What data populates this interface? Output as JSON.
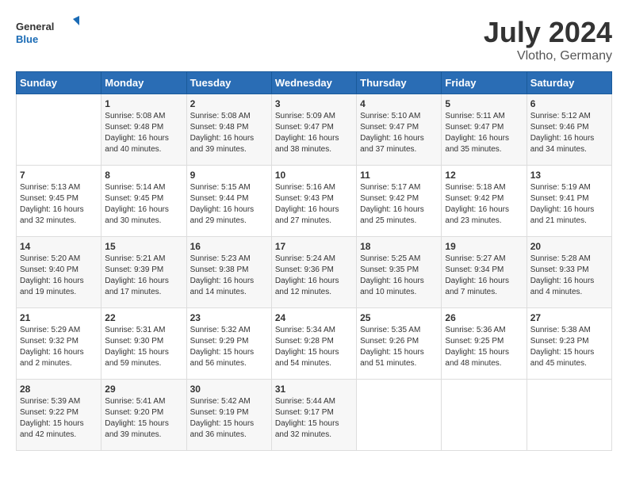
{
  "header": {
    "logo_line1": "General",
    "logo_line2": "Blue",
    "month": "July 2024",
    "location": "Vlotho, Germany"
  },
  "weekdays": [
    "Sunday",
    "Monday",
    "Tuesday",
    "Wednesday",
    "Thursday",
    "Friday",
    "Saturday"
  ],
  "weeks": [
    [
      {
        "day": "",
        "info": ""
      },
      {
        "day": "1",
        "info": "Sunrise: 5:08 AM\nSunset: 9:48 PM\nDaylight: 16 hours\nand 40 minutes."
      },
      {
        "day": "2",
        "info": "Sunrise: 5:08 AM\nSunset: 9:48 PM\nDaylight: 16 hours\nand 39 minutes."
      },
      {
        "day": "3",
        "info": "Sunrise: 5:09 AM\nSunset: 9:47 PM\nDaylight: 16 hours\nand 38 minutes."
      },
      {
        "day": "4",
        "info": "Sunrise: 5:10 AM\nSunset: 9:47 PM\nDaylight: 16 hours\nand 37 minutes."
      },
      {
        "day": "5",
        "info": "Sunrise: 5:11 AM\nSunset: 9:47 PM\nDaylight: 16 hours\nand 35 minutes."
      },
      {
        "day": "6",
        "info": "Sunrise: 5:12 AM\nSunset: 9:46 PM\nDaylight: 16 hours\nand 34 minutes."
      }
    ],
    [
      {
        "day": "7",
        "info": "Sunrise: 5:13 AM\nSunset: 9:45 PM\nDaylight: 16 hours\nand 32 minutes."
      },
      {
        "day": "8",
        "info": "Sunrise: 5:14 AM\nSunset: 9:45 PM\nDaylight: 16 hours\nand 30 minutes."
      },
      {
        "day": "9",
        "info": "Sunrise: 5:15 AM\nSunset: 9:44 PM\nDaylight: 16 hours\nand 29 minutes."
      },
      {
        "day": "10",
        "info": "Sunrise: 5:16 AM\nSunset: 9:43 PM\nDaylight: 16 hours\nand 27 minutes."
      },
      {
        "day": "11",
        "info": "Sunrise: 5:17 AM\nSunset: 9:42 PM\nDaylight: 16 hours\nand 25 minutes."
      },
      {
        "day": "12",
        "info": "Sunrise: 5:18 AM\nSunset: 9:42 PM\nDaylight: 16 hours\nand 23 minutes."
      },
      {
        "day": "13",
        "info": "Sunrise: 5:19 AM\nSunset: 9:41 PM\nDaylight: 16 hours\nand 21 minutes."
      }
    ],
    [
      {
        "day": "14",
        "info": "Sunrise: 5:20 AM\nSunset: 9:40 PM\nDaylight: 16 hours\nand 19 minutes."
      },
      {
        "day": "15",
        "info": "Sunrise: 5:21 AM\nSunset: 9:39 PM\nDaylight: 16 hours\nand 17 minutes."
      },
      {
        "day": "16",
        "info": "Sunrise: 5:23 AM\nSunset: 9:38 PM\nDaylight: 16 hours\nand 14 minutes."
      },
      {
        "day": "17",
        "info": "Sunrise: 5:24 AM\nSunset: 9:36 PM\nDaylight: 16 hours\nand 12 minutes."
      },
      {
        "day": "18",
        "info": "Sunrise: 5:25 AM\nSunset: 9:35 PM\nDaylight: 16 hours\nand 10 minutes."
      },
      {
        "day": "19",
        "info": "Sunrise: 5:27 AM\nSunset: 9:34 PM\nDaylight: 16 hours\nand 7 minutes."
      },
      {
        "day": "20",
        "info": "Sunrise: 5:28 AM\nSunset: 9:33 PM\nDaylight: 16 hours\nand 4 minutes."
      }
    ],
    [
      {
        "day": "21",
        "info": "Sunrise: 5:29 AM\nSunset: 9:32 PM\nDaylight: 16 hours\nand 2 minutes."
      },
      {
        "day": "22",
        "info": "Sunrise: 5:31 AM\nSunset: 9:30 PM\nDaylight: 15 hours\nand 59 minutes."
      },
      {
        "day": "23",
        "info": "Sunrise: 5:32 AM\nSunset: 9:29 PM\nDaylight: 15 hours\nand 56 minutes."
      },
      {
        "day": "24",
        "info": "Sunrise: 5:34 AM\nSunset: 9:28 PM\nDaylight: 15 hours\nand 54 minutes."
      },
      {
        "day": "25",
        "info": "Sunrise: 5:35 AM\nSunset: 9:26 PM\nDaylight: 15 hours\nand 51 minutes."
      },
      {
        "day": "26",
        "info": "Sunrise: 5:36 AM\nSunset: 9:25 PM\nDaylight: 15 hours\nand 48 minutes."
      },
      {
        "day": "27",
        "info": "Sunrise: 5:38 AM\nSunset: 9:23 PM\nDaylight: 15 hours\nand 45 minutes."
      }
    ],
    [
      {
        "day": "28",
        "info": "Sunrise: 5:39 AM\nSunset: 9:22 PM\nDaylight: 15 hours\nand 42 minutes."
      },
      {
        "day": "29",
        "info": "Sunrise: 5:41 AM\nSunset: 9:20 PM\nDaylight: 15 hours\nand 39 minutes."
      },
      {
        "day": "30",
        "info": "Sunrise: 5:42 AM\nSunset: 9:19 PM\nDaylight: 15 hours\nand 36 minutes."
      },
      {
        "day": "31",
        "info": "Sunrise: 5:44 AM\nSunset: 9:17 PM\nDaylight: 15 hours\nand 32 minutes."
      },
      {
        "day": "",
        "info": ""
      },
      {
        "day": "",
        "info": ""
      },
      {
        "day": "",
        "info": ""
      }
    ]
  ]
}
